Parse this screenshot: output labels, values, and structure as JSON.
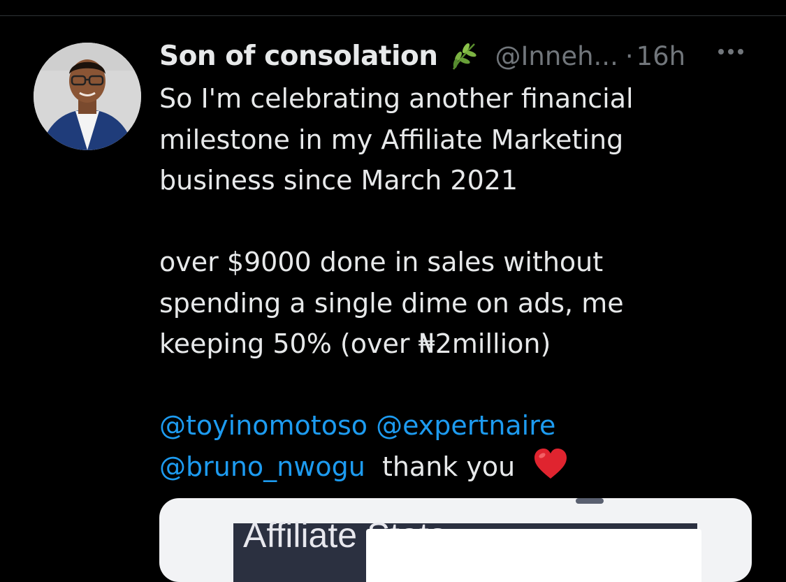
{
  "tweet": {
    "display_name": "Son of consolation",
    "name_icon": "leaf-icon",
    "handle": "@Inneh...",
    "dot": "·",
    "time": "16h",
    "more_icon": "more-icon",
    "body_lines": [
      "So I'm celebrating another financial",
      "milestone in my Affiliate Marketing",
      "business since March 2021",
      "",
      "over $9000 done in sales without",
      "spending a single dime on ads, me",
      "keeping 50% (over ₦2million)"
    ],
    "mentions": [
      "@toyinomotoso",
      "@expertnaire",
      "@bruno_nwogu"
    ],
    "thanks": "thank you",
    "heart_icon": "red-heart-icon"
  },
  "media": {
    "title": "Affiliate Stats"
  },
  "colors": {
    "background": "#000000",
    "text": "#e7e9ea",
    "secondary": "#71767b",
    "link": "#1d9bf0",
    "heart": "#e0242f"
  }
}
